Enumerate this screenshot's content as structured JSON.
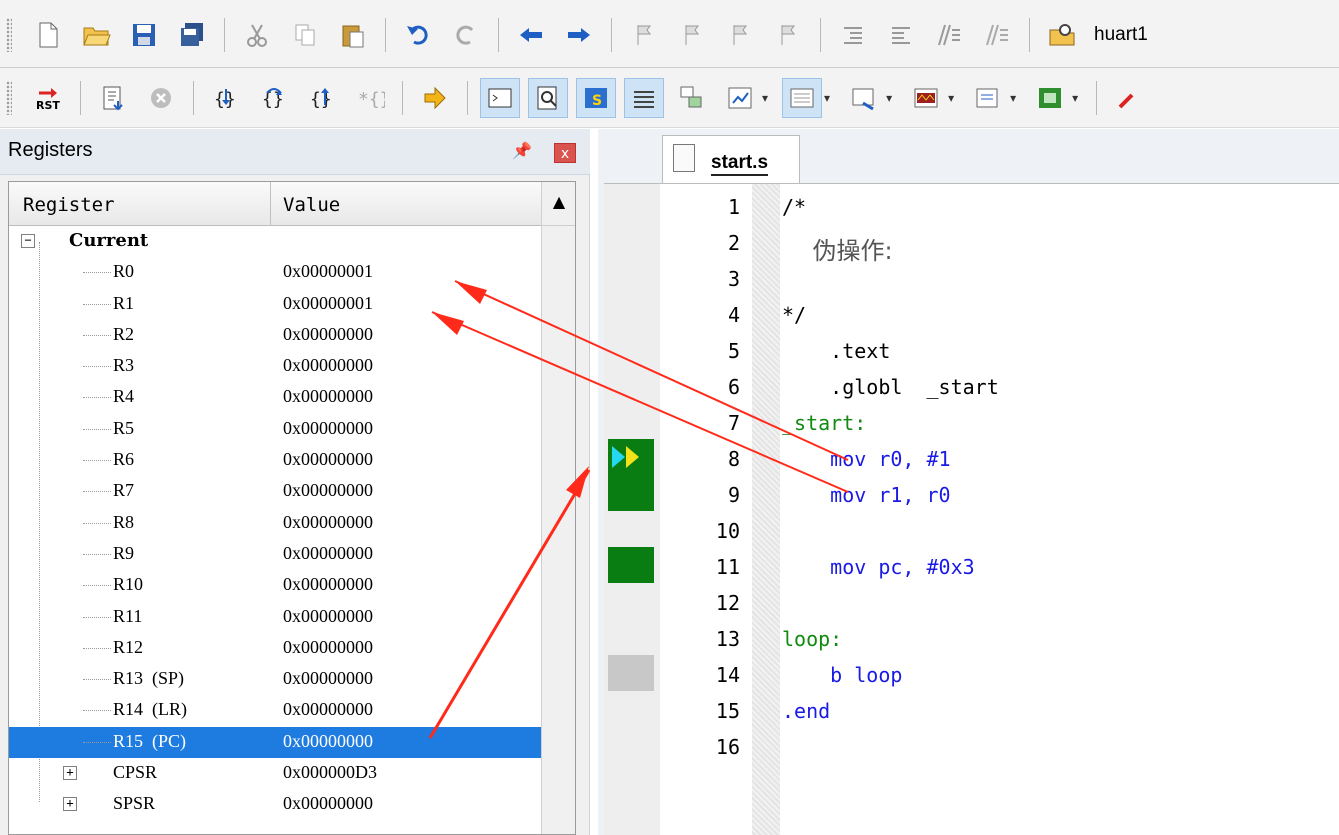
{
  "toolbar1": {
    "target_name": "huart1"
  },
  "registers": {
    "title": "Registers",
    "pin_icon": "pin-icon",
    "close_label": "x",
    "headers": {
      "register": "Register",
      "value": "Value"
    },
    "group": "Current",
    "rows": [
      {
        "name": "R0",
        "value": "0x00000001"
      },
      {
        "name": "R1",
        "value": "0x00000001"
      },
      {
        "name": "R2",
        "value": "0x00000000"
      },
      {
        "name": "R3",
        "value": "0x00000000"
      },
      {
        "name": "R4",
        "value": "0x00000000"
      },
      {
        "name": "R5",
        "value": "0x00000000"
      },
      {
        "name": "R6",
        "value": "0x00000000"
      },
      {
        "name": "R7",
        "value": "0x00000000"
      },
      {
        "name": "R8",
        "value": "0x00000000"
      },
      {
        "name": "R9",
        "value": "0x00000000"
      },
      {
        "name": "R10",
        "value": "0x00000000"
      },
      {
        "name": "R11",
        "value": "0x00000000"
      },
      {
        "name": "R12",
        "value": "0x00000000"
      },
      {
        "name": "R13  (SP)",
        "value": "0x00000000"
      },
      {
        "name": "R14  (LR)",
        "value": "0x00000000"
      },
      {
        "name": "R15  (PC)",
        "value": "0x00000000",
        "selected": true
      }
    ],
    "collapsed": [
      {
        "name": "CPSR",
        "value": "0x000000D3"
      },
      {
        "name": "SPSR",
        "value": "0x00000000"
      }
    ]
  },
  "editor": {
    "tab_label": "start.s",
    "lines": [
      {
        "n": "1",
        "text": "/*"
      },
      {
        "n": "2",
        "text": "伪操作:"
      },
      {
        "n": "3",
        "text": ""
      },
      {
        "n": "4",
        "text": "*/"
      },
      {
        "n": "5",
        "text": ".text"
      },
      {
        "n": "6",
        "text": ".globl  _start"
      },
      {
        "n": "7",
        "text": "_start:"
      },
      {
        "n": "8",
        "text": "mov r0, #1"
      },
      {
        "n": "9",
        "text": "mov r1, r0"
      },
      {
        "n": "10",
        "text": ""
      },
      {
        "n": "11",
        "text": "mov pc, #0x3"
      },
      {
        "n": "12",
        "text": ""
      },
      {
        "n": "13",
        "text": "loop:"
      },
      {
        "n": "14",
        "text": "b loop"
      },
      {
        "n": "15",
        "text": ".end"
      },
      {
        "n": "16",
        "text": ""
      }
    ]
  },
  "annotation_color": "#ff2a1a"
}
